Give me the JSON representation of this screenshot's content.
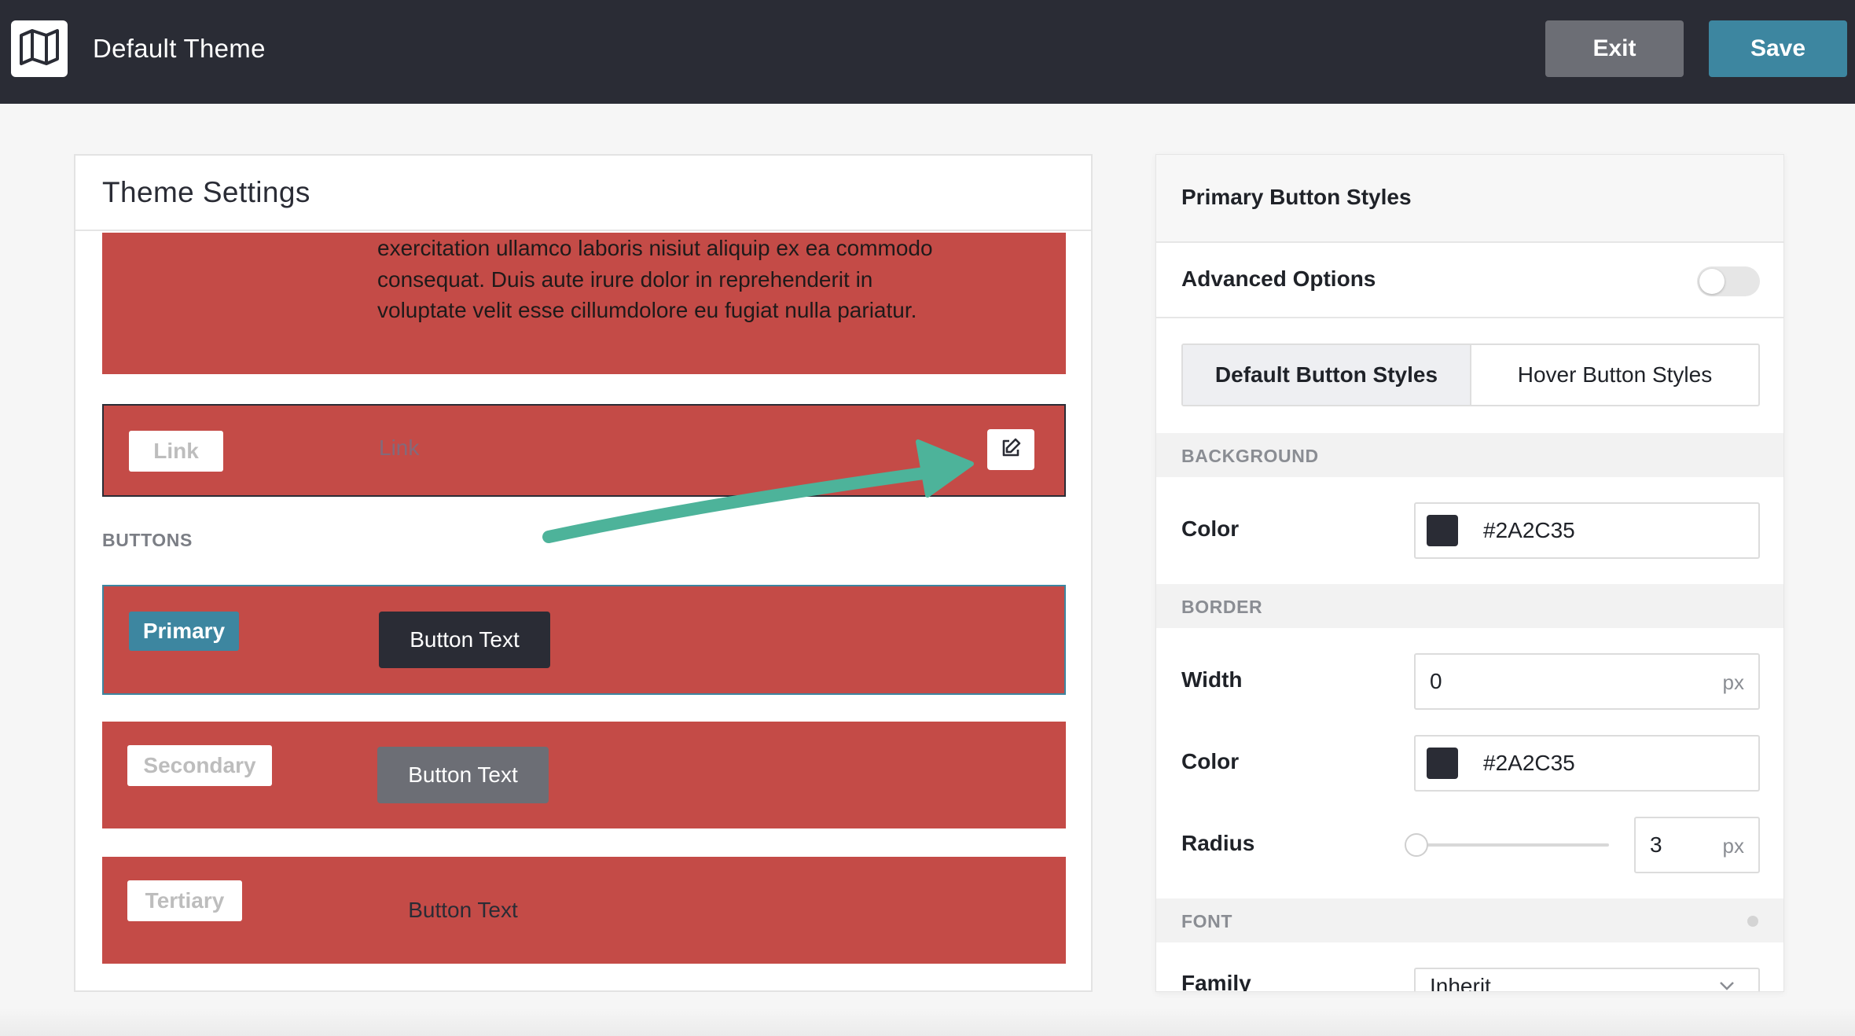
{
  "app": {
    "title": "Default Theme",
    "exit_label": "Exit",
    "save_label": "Save",
    "logo_icon": "map-icon"
  },
  "theme_settings": {
    "title": "Theme Settings",
    "paragraph_preview": "exercitation ullamco laboris nisiut aliquip ex ea commodo consequat. Duis aute irure dolor in reprehenderit in voluptate velit esse cillumdolore eu fugiat nulla pariatur.",
    "link": {
      "tag": "Link",
      "preview": "Link",
      "edit_icon": "edit-icon"
    },
    "buttons_section_label": "BUTTONS",
    "buttons": [
      {
        "tag": "Primary",
        "sample": "Button Text"
      },
      {
        "tag": "Secondary",
        "sample": "Button Text"
      },
      {
        "tag": "Tertiary",
        "sample": "Button Text"
      }
    ]
  },
  "panel": {
    "title": "Primary Button Styles",
    "advanced_options_label": "Advanced Options",
    "advanced_options_enabled": false,
    "tabs": [
      {
        "label": "Default Button Styles",
        "active": true
      },
      {
        "label": "Hover Button Styles",
        "active": false
      }
    ],
    "background": {
      "section_label": "BACKGROUND",
      "color_label": "Color",
      "color_value": "#2A2C35"
    },
    "border": {
      "section_label": "BORDER",
      "width_label": "Width",
      "width_value": "0",
      "width_unit": "px",
      "color_label": "Color",
      "color_value": "#2A2C35",
      "radius_label": "Radius",
      "radius_value": "3",
      "radius_unit": "px"
    },
    "font": {
      "section_label": "FONT",
      "family_label": "Family",
      "family_value": "Inherit"
    }
  },
  "colors": {
    "topbar": "#2a2c35",
    "accent": "#3d86a0",
    "preview_red": "#c44b47",
    "arrow": "#4db39a"
  }
}
